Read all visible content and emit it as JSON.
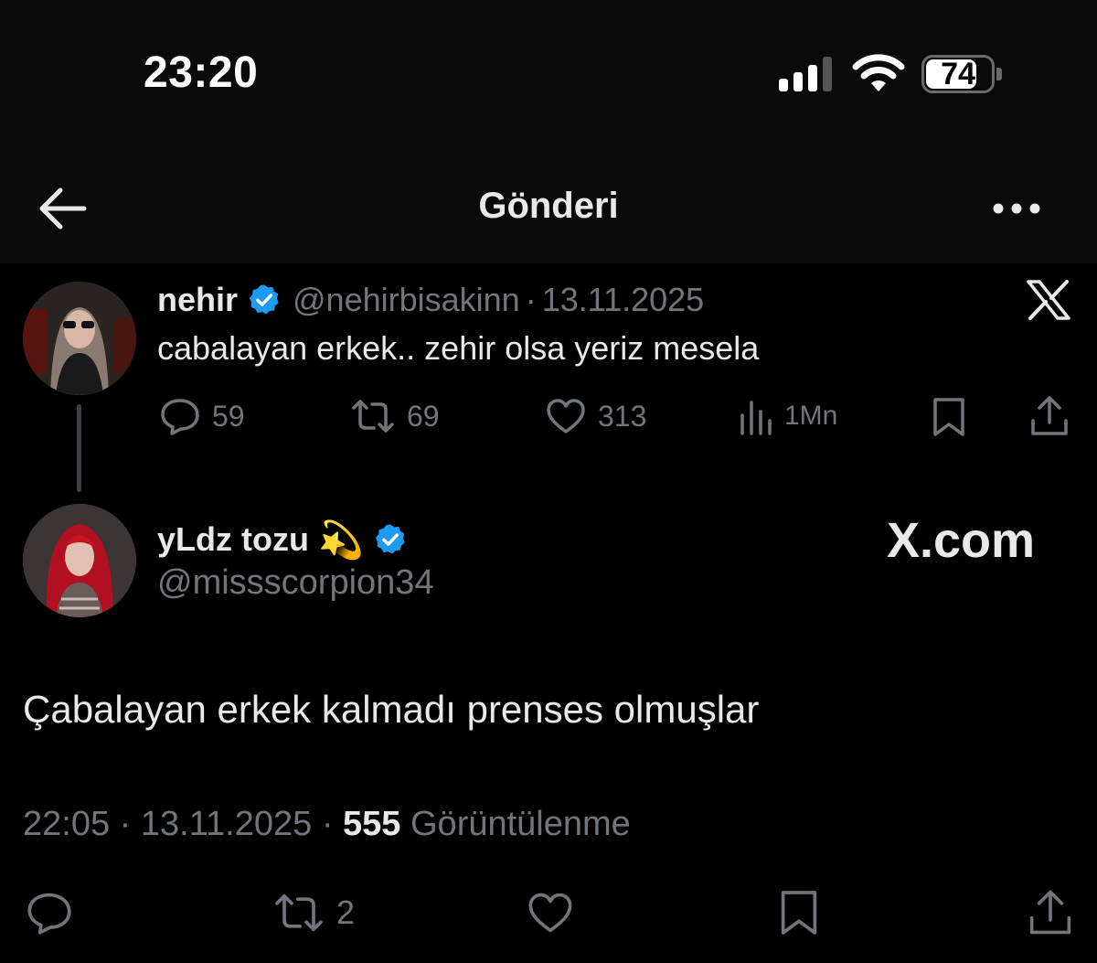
{
  "status_bar": {
    "time": "23:20",
    "battery_level": "74"
  },
  "nav": {
    "title": "Gönderi"
  },
  "tweet_quoted": {
    "name": "nehir",
    "handle": "@nehirbisakinn",
    "separator": "·",
    "date": "13.11.2025",
    "text": "cabalayan erkek.. zehir olsa yeriz mesela",
    "replies": "59",
    "reposts": "69",
    "likes": "313",
    "views": "1Mn"
  },
  "tweet_main": {
    "name": "yLdz tozu",
    "emoji": "💫",
    "handle": "@missscorpion34",
    "watermark": "X.com",
    "text": "Çabalayan erkek kalmadı prenses olmuşlar",
    "time": "22:05",
    "separator": "·",
    "date": "13.11.2025",
    "views_count": "555",
    "views_label": "Görüntülenme",
    "reposts": "2"
  },
  "colors": {
    "background": "#000000",
    "text_primary": "#e7e9ea",
    "text_secondary": "#71767b",
    "verified_blue": "#1d9bf0",
    "thread_line": "#3c4043"
  },
  "icons": [
    "back-arrow-icon",
    "more-icon",
    "verified-icon",
    "x-logo-icon",
    "reply-icon",
    "repost-icon",
    "like-icon",
    "views-icon",
    "bookmark-icon",
    "share-icon",
    "signal-icon",
    "wifi-icon",
    "battery-icon"
  ]
}
